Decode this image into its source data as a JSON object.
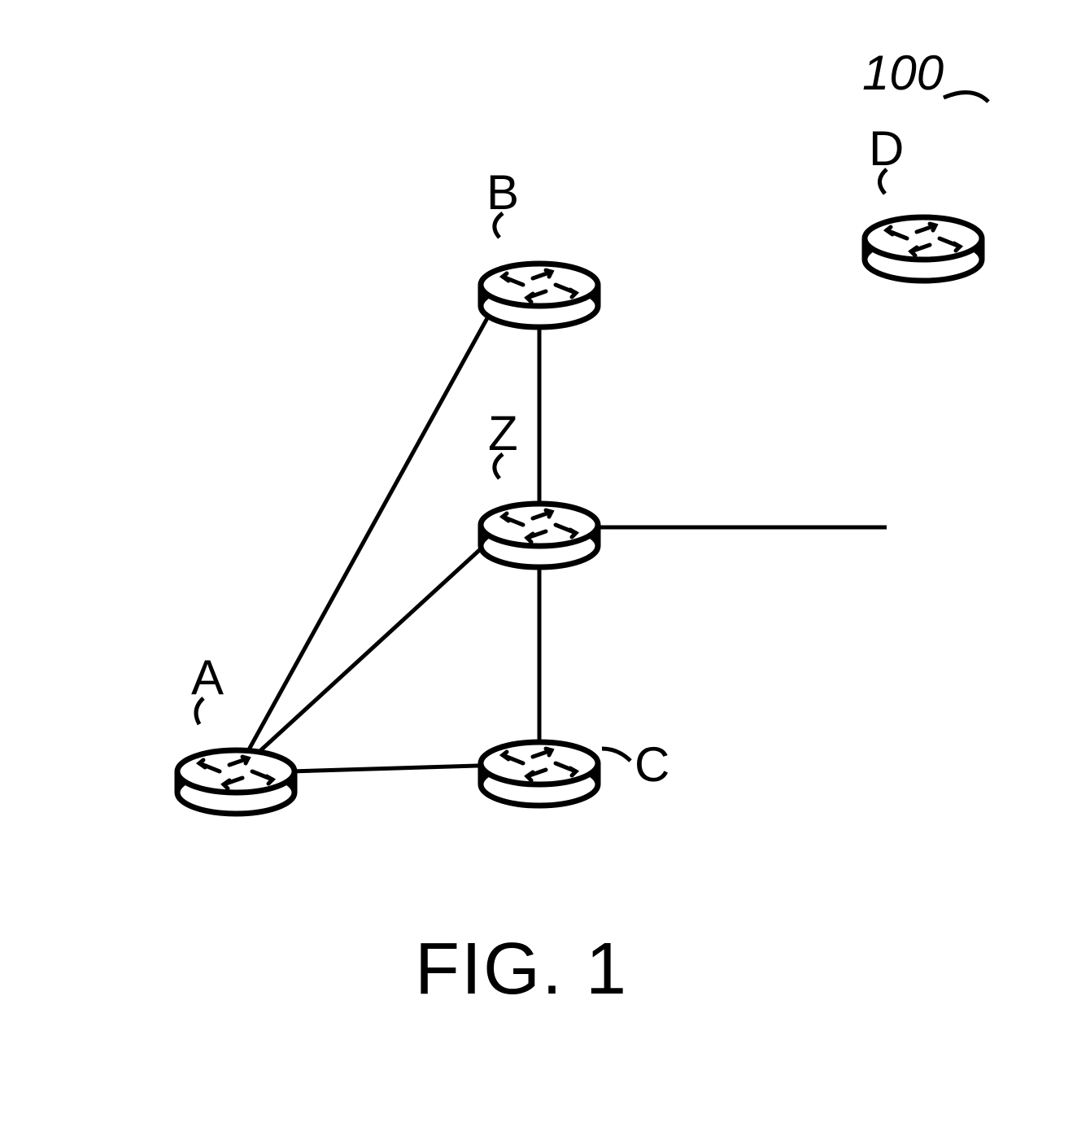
{
  "figure_label": "FIG. 1",
  "reference_numeral": "100",
  "nodes": {
    "A": {
      "label": "A"
    },
    "B": {
      "label": "B"
    },
    "Z": {
      "label": "Z"
    },
    "C": {
      "label": "C"
    },
    "D": {
      "label": "D"
    }
  },
  "edges": [
    [
      "A",
      "B"
    ],
    [
      "A",
      "Z"
    ],
    [
      "A",
      "C"
    ],
    [
      "B",
      "Z"
    ],
    [
      "Z",
      "C"
    ],
    [
      "Z",
      "D"
    ]
  ]
}
